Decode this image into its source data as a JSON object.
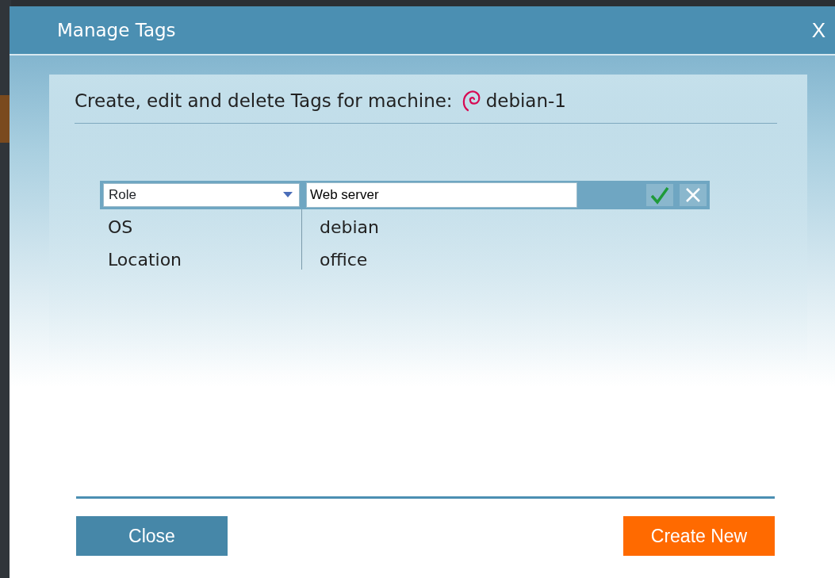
{
  "dialog": {
    "title": "Manage Tags",
    "close_glyph": "X"
  },
  "header": {
    "text": "Create, edit and delete Tags for machine:",
    "machine": "debian-1"
  },
  "editor": {
    "key": "Role",
    "value": "Web server"
  },
  "tags": [
    {
      "key": "OS",
      "value": "debian"
    },
    {
      "key": "Location",
      "value": "office"
    }
  ],
  "buttons": [
    {
      "label": "Close",
      "kind": "secondary"
    },
    {
      "label": "Create New",
      "kind": "primary"
    }
  ]
}
